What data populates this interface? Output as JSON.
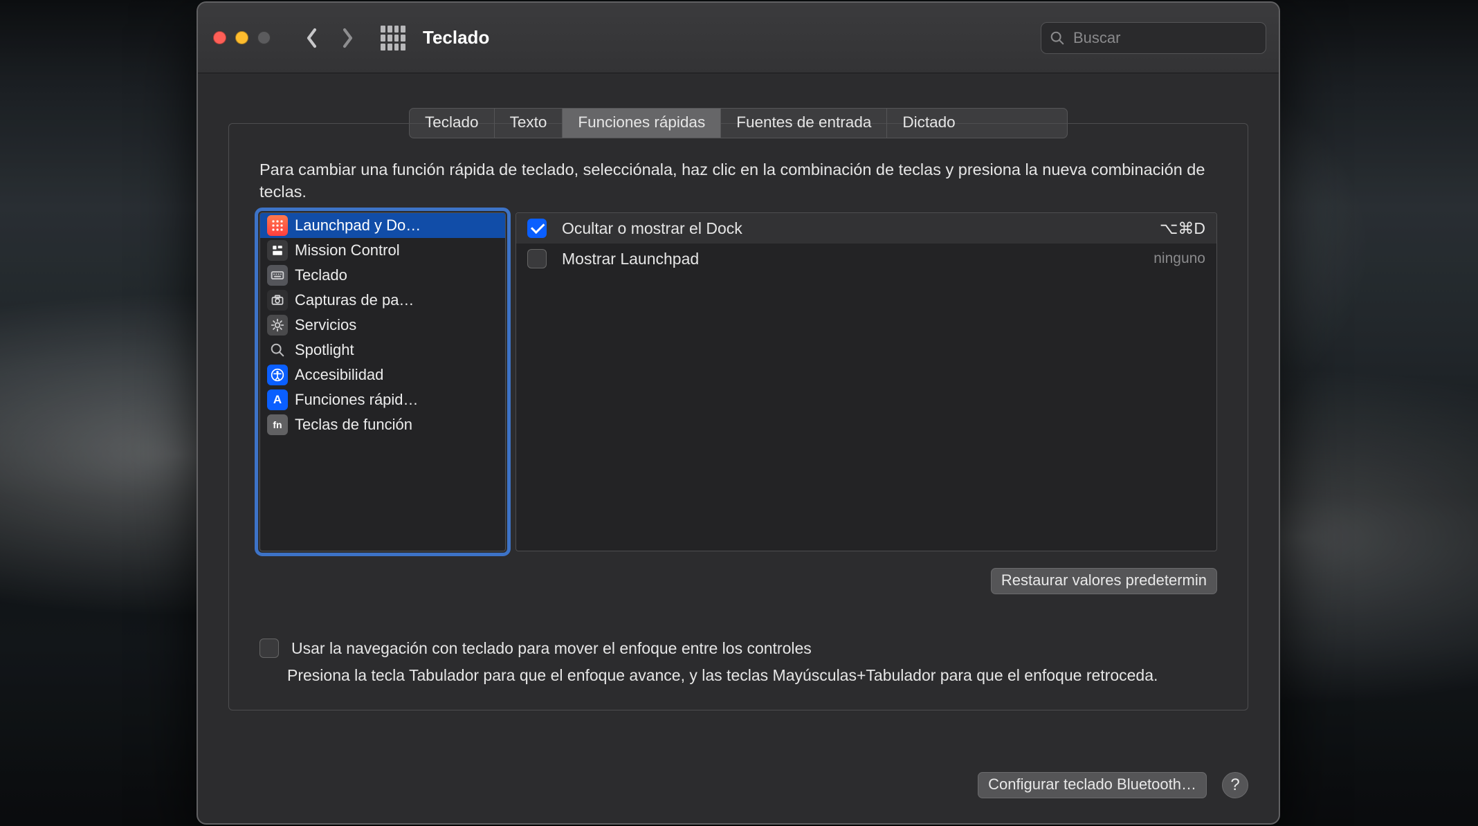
{
  "window": {
    "title": "Teclado",
    "search_placeholder": "Buscar"
  },
  "tabs": [
    {
      "id": "teclado",
      "label": "Teclado",
      "active": false
    },
    {
      "id": "texto",
      "label": "Texto",
      "active": false
    },
    {
      "id": "shortcuts",
      "label": "Funciones rápidas",
      "active": true
    },
    {
      "id": "fuentes",
      "label": "Fuentes de entrada",
      "active": false
    },
    {
      "id": "dictado",
      "label": "Dictado",
      "active": false
    }
  ],
  "instructions": "Para cambiar una función rápida de teclado, selecciónala, haz clic en la combinación de teclas y presiona la nueva combinación de teclas.",
  "categories": [
    {
      "id": "launchpad",
      "label": "Launchpad y Do…",
      "selected": true
    },
    {
      "id": "mission",
      "label": "Mission Control",
      "selected": false
    },
    {
      "id": "keyboard",
      "label": "Teclado",
      "selected": false
    },
    {
      "id": "screenshots",
      "label": "Capturas de pa…",
      "selected": false
    },
    {
      "id": "services",
      "label": "Servicios",
      "selected": false
    },
    {
      "id": "spotlight",
      "label": "Spotlight",
      "selected": false
    },
    {
      "id": "accessibility",
      "label": "Accesibilidad",
      "selected": false
    },
    {
      "id": "appshortcuts",
      "label": "Funciones rápid…",
      "selected": false
    },
    {
      "id": "fnkeys",
      "label": "Teclas de función",
      "selected": false
    }
  ],
  "shortcuts": [
    {
      "enabled": true,
      "label": "Ocultar o mostrar el Dock",
      "key": "⌥⌘D",
      "none_label": ""
    },
    {
      "enabled": false,
      "label": "Mostrar Launchpad",
      "key": "",
      "none_label": "ninguno"
    }
  ],
  "buttons": {
    "restore": "Restaurar valores predetermin",
    "bluetooth": "Configurar teclado Bluetooth…"
  },
  "kbnav": {
    "checkbox_label": "Usar la navegación con teclado para mover el enfoque entre los controles",
    "note": "Presiona la tecla Tabulador para que el enfoque avance, y las teclas Mayúsculas+Tabulador para que el enfoque retroceda."
  }
}
